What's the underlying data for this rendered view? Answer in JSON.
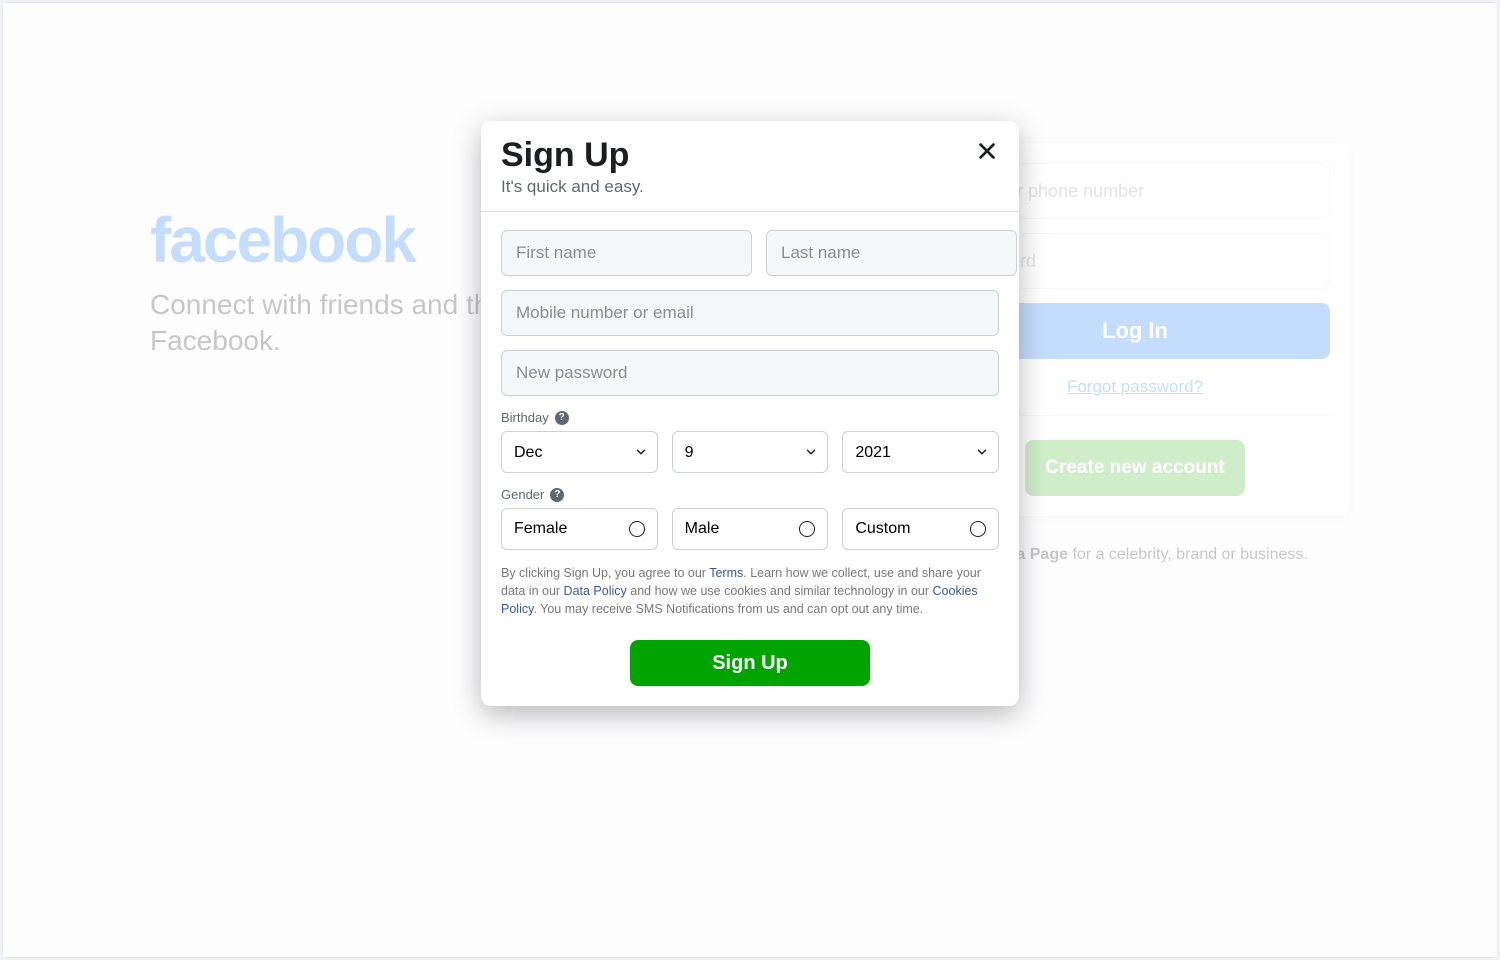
{
  "logo": "facebook",
  "tagline": "Connect with friends and the world around you on Facebook.",
  "login": {
    "email_placeholder": "Email or phone number",
    "password_placeholder": "Password",
    "login_label": "Log In",
    "forgot_label": "Forgot password?",
    "create_label": "Create new account"
  },
  "page_link": {
    "bold": "Create a Page",
    "rest": " for a celebrity, brand or business."
  },
  "modal": {
    "title": "Sign Up",
    "subtitle": "It's quick and easy.",
    "first_name_placeholder": "First name",
    "last_name_placeholder": "Last name",
    "contact_placeholder": "Mobile number or email",
    "password_placeholder": "New password",
    "birthday_label": "Birthday",
    "birthday": {
      "month": "Dec",
      "day": "9",
      "year": "2021"
    },
    "gender_label": "Gender",
    "gender_options": [
      "Female",
      "Male",
      "Custom"
    ],
    "legal": {
      "p1": "By clicking Sign Up, you agree to our ",
      "terms": "Terms",
      "p2": ". Learn how we collect, use and share your data in our ",
      "data_policy": "Data Policy",
      "p3": " and how we use cookies and similar technology in our ",
      "cookies_policy": "Cookies Policy",
      "p4": ". You may receive SMS Notifications from us and can opt out any time."
    },
    "signup_label": "Sign Up"
  }
}
